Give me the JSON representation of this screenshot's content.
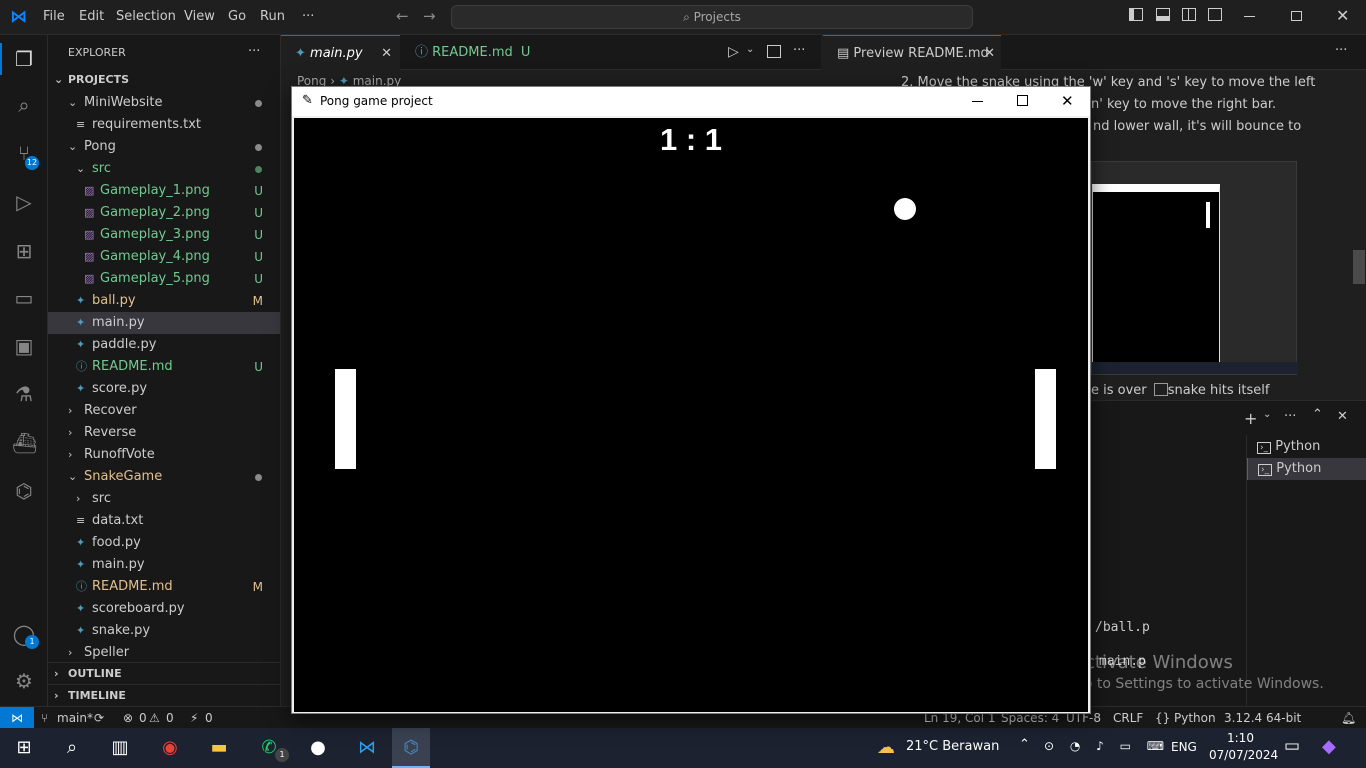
{
  "titlebar": {
    "menu": [
      "File",
      "Edit",
      "Selection",
      "View",
      "Go",
      "Run",
      "···"
    ],
    "search": "Projects"
  },
  "activity": {
    "scm_badge": "12",
    "account_badge": "1"
  },
  "sidebar": {
    "title": "EXPLORER",
    "more": "···",
    "root": "PROJECTS",
    "items": [
      {
        "label": "MiniWebsite",
        "status": ""
      },
      {
        "label": "requirements.txt",
        "status": ""
      },
      {
        "label": "Pong",
        "status": ""
      },
      {
        "label": "src",
        "status": ""
      },
      {
        "label": "Gameplay_1.png",
        "status": "U"
      },
      {
        "label": "Gameplay_2.png",
        "status": "U"
      },
      {
        "label": "Gameplay_3.png",
        "status": "U"
      },
      {
        "label": "Gameplay_4.png",
        "status": "U"
      },
      {
        "label": "Gameplay_5.png",
        "status": "U"
      },
      {
        "label": "ball.py",
        "status": "M"
      },
      {
        "label": "main.py",
        "status": ""
      },
      {
        "label": "paddle.py",
        "status": ""
      },
      {
        "label": "README.md",
        "status": "U"
      },
      {
        "label": "score.py",
        "status": ""
      },
      {
        "label": "Recover",
        "status": ""
      },
      {
        "label": "Reverse",
        "status": ""
      },
      {
        "label": "RunoffVote",
        "status": ""
      },
      {
        "label": "SnakeGame",
        "status": ""
      },
      {
        "label": "src",
        "status": ""
      },
      {
        "label": "data.txt",
        "status": ""
      },
      {
        "label": "food.py",
        "status": ""
      },
      {
        "label": "main.py",
        "status": ""
      },
      {
        "label": "README.md",
        "status": "M"
      },
      {
        "label": "scoreboard.py",
        "status": ""
      },
      {
        "label": "snake.py",
        "status": ""
      },
      {
        "label": "Speller",
        "status": ""
      }
    ],
    "outline": "OUTLINE",
    "timeline": "TIMELINE"
  },
  "tabs": {
    "main": "main.py",
    "readme": "README.md",
    "readme_status": "U",
    "preview": "Preview README.md"
  },
  "breadcrumb": [
    "Pong",
    "main.py"
  ],
  "preview": {
    "line1": "2. Move the snake using the 'w' key and 's' key to move the left",
    "line2": "n' key to move the right bar.",
    "line3": "nd lower wall, it's will bounce to",
    "line4": "e is over",
    "line4b": "snake hits itself"
  },
  "terminal": {
    "tabs": [
      "Python",
      "Python"
    ],
    "line1": "/ball.p",
    "line2": "main.p"
  },
  "watermark": {
    "title": "Activate Windows",
    "subtitle": "Go to Settings to activate Windows."
  },
  "pong": {
    "title": "Pong game project",
    "score": "1 : 1"
  },
  "statusbar": {
    "branch": "main*",
    "problems": "0",
    "warnings": "0",
    "ports": "0",
    "position": "Ln 19, Col 1",
    "spaces": "Spaces: 4",
    "encoding": "UTF-8",
    "eol": "CRLF",
    "language": "Python",
    "interpreter": "3.12.4 64-bit"
  },
  "taskbar": {
    "weather": "21°C  Berawan",
    "lang": "ENG",
    "time": "1:10",
    "date": "07/07/2024",
    "notif_badge": "1"
  },
  "colors": {
    "accent": "#0078d4",
    "untracked": "#73c991",
    "modified": "#e2c08d"
  }
}
